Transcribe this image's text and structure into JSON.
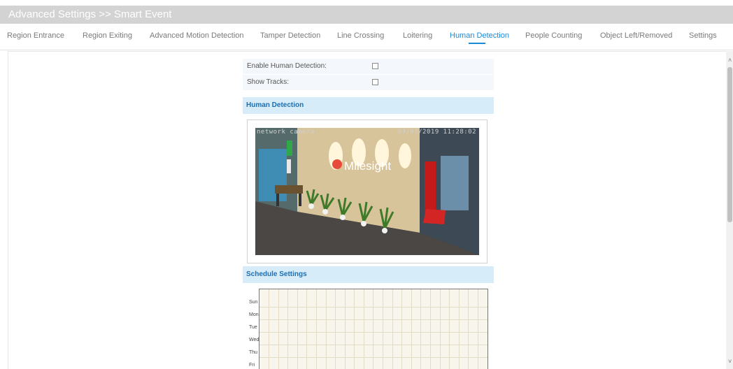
{
  "header": {
    "breadcrumb": "Advanced Settings >> Smart Event"
  },
  "tabs": [
    {
      "label": "Region Entrance",
      "active": false
    },
    {
      "label": "Region Exiting",
      "active": false
    },
    {
      "label": "Advanced Motion Detection",
      "active": false
    },
    {
      "label": "Tamper Detection",
      "active": false
    },
    {
      "label": "Line Crossing",
      "active": false
    },
    {
      "label": "Loitering",
      "active": false
    },
    {
      "label": "Human Detection",
      "active": true
    },
    {
      "label": "People Counting",
      "active": false
    },
    {
      "label": "Object Left/Removed",
      "active": false
    },
    {
      "label": "Settings",
      "active": false
    }
  ],
  "form": {
    "enable_label": "Enable Human Detection:",
    "enable_checked": false,
    "tracks_label": "Show Tracks:",
    "tracks_checked": false
  },
  "sections": {
    "human_detection": "Human Detection",
    "schedule_settings": "Schedule Settings"
  },
  "video": {
    "osd_name": "network camera",
    "osd_time": "03/07/2019 11:28:02",
    "logo_text": "Milesight"
  },
  "schedule": {
    "days": [
      "Sun",
      "Mon",
      "Tue",
      "Wed",
      "Thu",
      "Fri"
    ]
  },
  "colors": {
    "accent": "#1a8ad8",
    "section_bg": "#d6ecf8",
    "section_text": "#1c6fb3",
    "title_bar": "#d3d3d3"
  }
}
